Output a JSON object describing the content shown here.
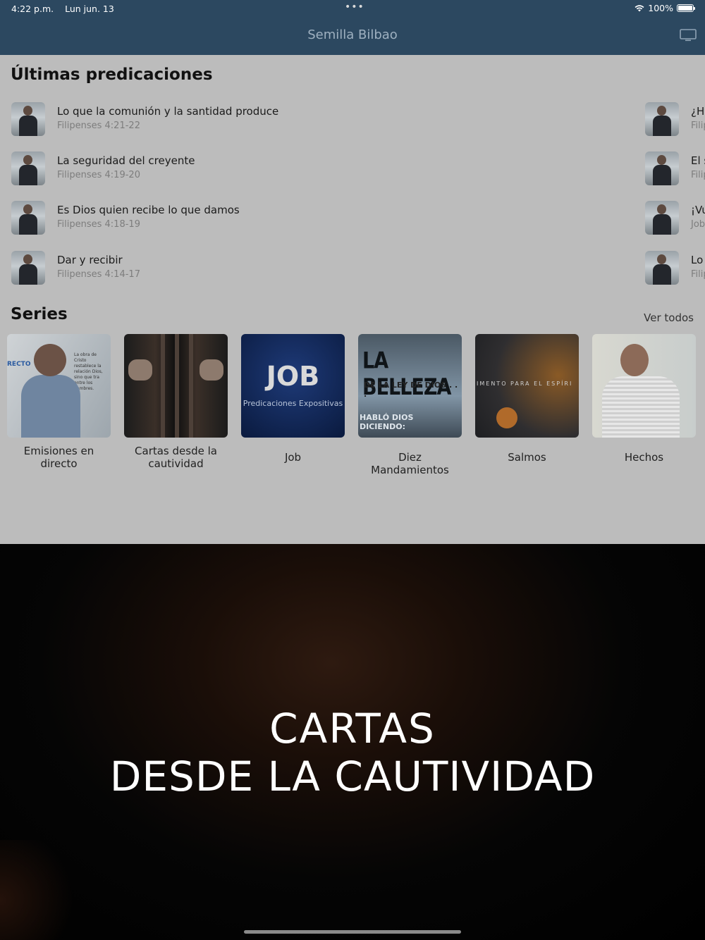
{
  "status_bar": {
    "time": "4:22 p.m.",
    "date": "Lun jun. 13",
    "dots": "•••",
    "battery": "100%",
    "wifi_icon": "wifi-icon",
    "battery_icon": "battery-icon"
  },
  "nav": {
    "title": "Semilla Bilbao",
    "tv_icon": "tv-airplay-icon"
  },
  "latest": {
    "heading": "Últimas predicaciones",
    "left": [
      {
        "title": "Lo que la comunión y la santidad produce",
        "ref": "Filipenses 4:21-22"
      },
      {
        "title": "La seguridad del creyente",
        "ref": "Filipenses 4:19-20"
      },
      {
        "title": "Es Dios quien recibe lo que damos",
        "ref": "Filipenses 4:18-19"
      },
      {
        "title": "Dar y recibir",
        "ref": "Filipenses 4:14-17"
      }
    ],
    "right": [
      {
        "title": "¿Ha",
        "ref": "Filip"
      },
      {
        "title": "El s",
        "ref": "Filip"
      },
      {
        "title": "¡Vu",
        "ref": "Job"
      },
      {
        "title": "Lo",
        "ref": "Filip"
      }
    ]
  },
  "series": {
    "heading": "Series",
    "see_all": "Ver todos",
    "items": [
      {
        "label": "Emisiones en directo",
        "art_tag": "RECTO",
        "art_text": "La obra de Cristo restablece la relación Dios, sino que tra entre los hombres."
      },
      {
        "label": "Cartas desde la cautividad"
      },
      {
        "label": "Job",
        "art_title": "JOB",
        "art_subtitle": "Predicaciones Expositivas"
      },
      {
        "label": "Diez Mandamientos",
        "art_title": "LA BELLEZA",
        "art_subtitle": "DE LA LEY DE DIOS . . .",
        "art_footer": "HABLÓ DIOS DICIENDO:"
      },
      {
        "label": "Salmos",
        "art_text": "IMENTO PARA  EL ESPÍRI"
      },
      {
        "label": "Hechos"
      }
    ]
  },
  "player": {
    "line1": "CARTAS",
    "line2": "DESDE LA CAUTIVIDAD"
  }
}
